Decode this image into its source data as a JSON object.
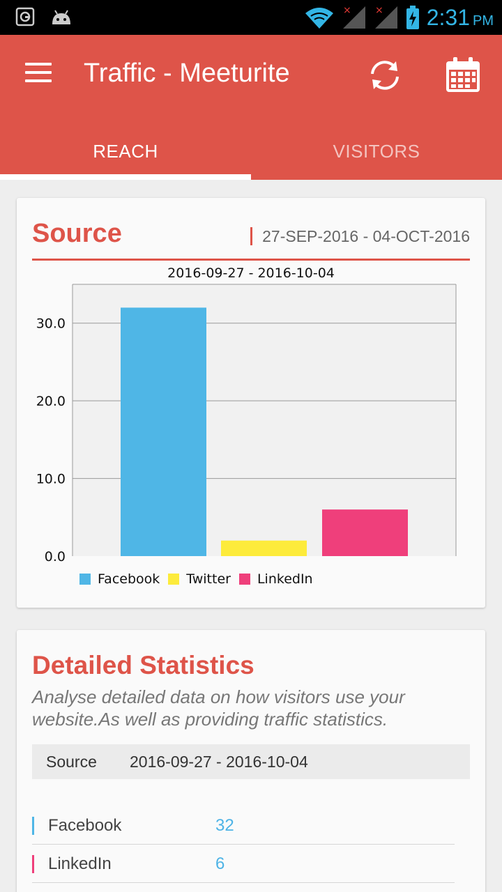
{
  "statusbar": {
    "time": "2:31",
    "ampm": "PM"
  },
  "toolbar": {
    "title": "Traffic - Meeturite",
    "tabs": [
      {
        "label": "REACH",
        "active": true
      },
      {
        "label": "VISITORS",
        "active": false
      }
    ]
  },
  "source_card": {
    "title": "Source",
    "date_range": "27-SEP-2016 - 04-OCT-2016",
    "chart_subtitle": "2016-09-27  -  2016-10-04"
  },
  "chart_data": {
    "type": "bar",
    "title": "2016-09-27  -  2016-10-04",
    "categories": [
      "Facebook",
      "Twitter",
      "LinkedIn"
    ],
    "values": [
      32,
      2,
      6
    ],
    "colors": [
      "#4fb6e6",
      "#fdeb3b",
      "#ef3f7b"
    ],
    "ylim": [
      0,
      35
    ],
    "yticks": [
      0,
      10,
      20,
      30
    ],
    "ytick_labels": [
      "0.0",
      "10.0",
      "20.0",
      "30.0"
    ],
    "grid": true,
    "legend": "bottom-left",
    "xlabel": "",
    "ylabel": ""
  },
  "stats_card": {
    "title": "Detailed Statistics",
    "description": "Analyse detailed data on how visitors use your website.As well as providing traffic statistics.",
    "header_label": "Source",
    "header_range": "2016-09-27  -  2016-10-04",
    "rows": [
      {
        "name": "Facebook",
        "value": "32",
        "color": "#4fb6e6"
      },
      {
        "name": "LinkedIn",
        "value": "6",
        "color": "#ef3f7b"
      }
    ]
  },
  "icons": {
    "menu": "hamburger-menu-icon",
    "refresh": "refresh-icon",
    "calendar": "calendar-icon"
  }
}
